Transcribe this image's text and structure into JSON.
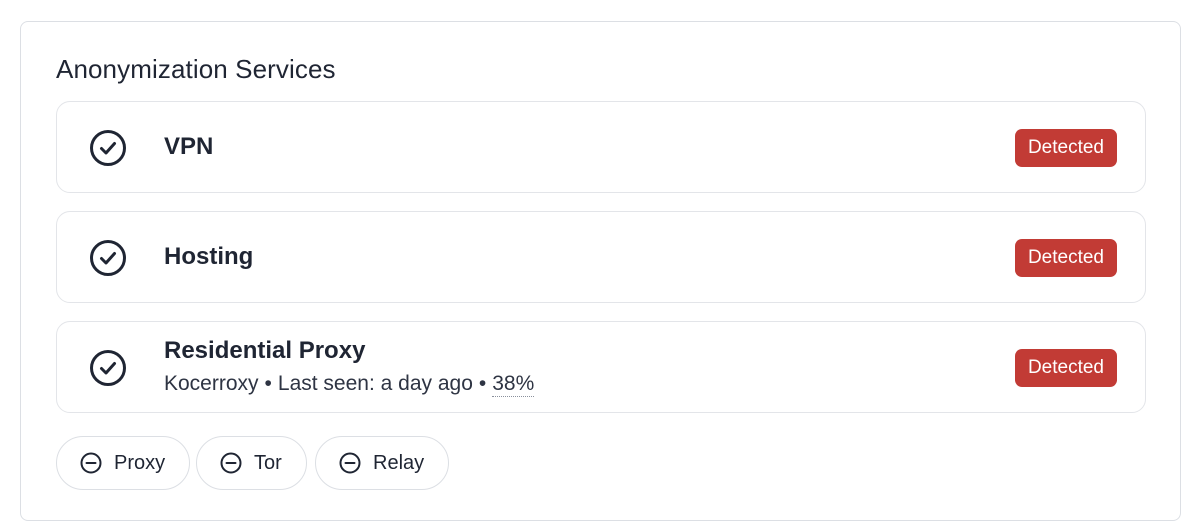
{
  "section": {
    "title": "Anonymization Services"
  },
  "services": [
    {
      "name": "VPN",
      "status": "Detected",
      "icon": "check-circle-icon"
    },
    {
      "name": "Hosting",
      "status": "Detected",
      "icon": "check-circle-icon"
    },
    {
      "name": "Residential Proxy",
      "status": "Detected",
      "icon": "check-circle-icon",
      "provider": "Kocerroxy",
      "separator": "•",
      "last_seen": "Last seen: a day ago",
      "confidence": "38%"
    }
  ],
  "filters": [
    {
      "label": "Proxy",
      "icon": "minus-circle-icon"
    },
    {
      "label": "Tor",
      "icon": "minus-circle-icon"
    },
    {
      "label": "Relay",
      "icon": "minus-circle-icon"
    }
  ],
  "colors": {
    "detected_badge": "#c23b35",
    "text": "#1f2533",
    "border": "#dcdfe4"
  }
}
